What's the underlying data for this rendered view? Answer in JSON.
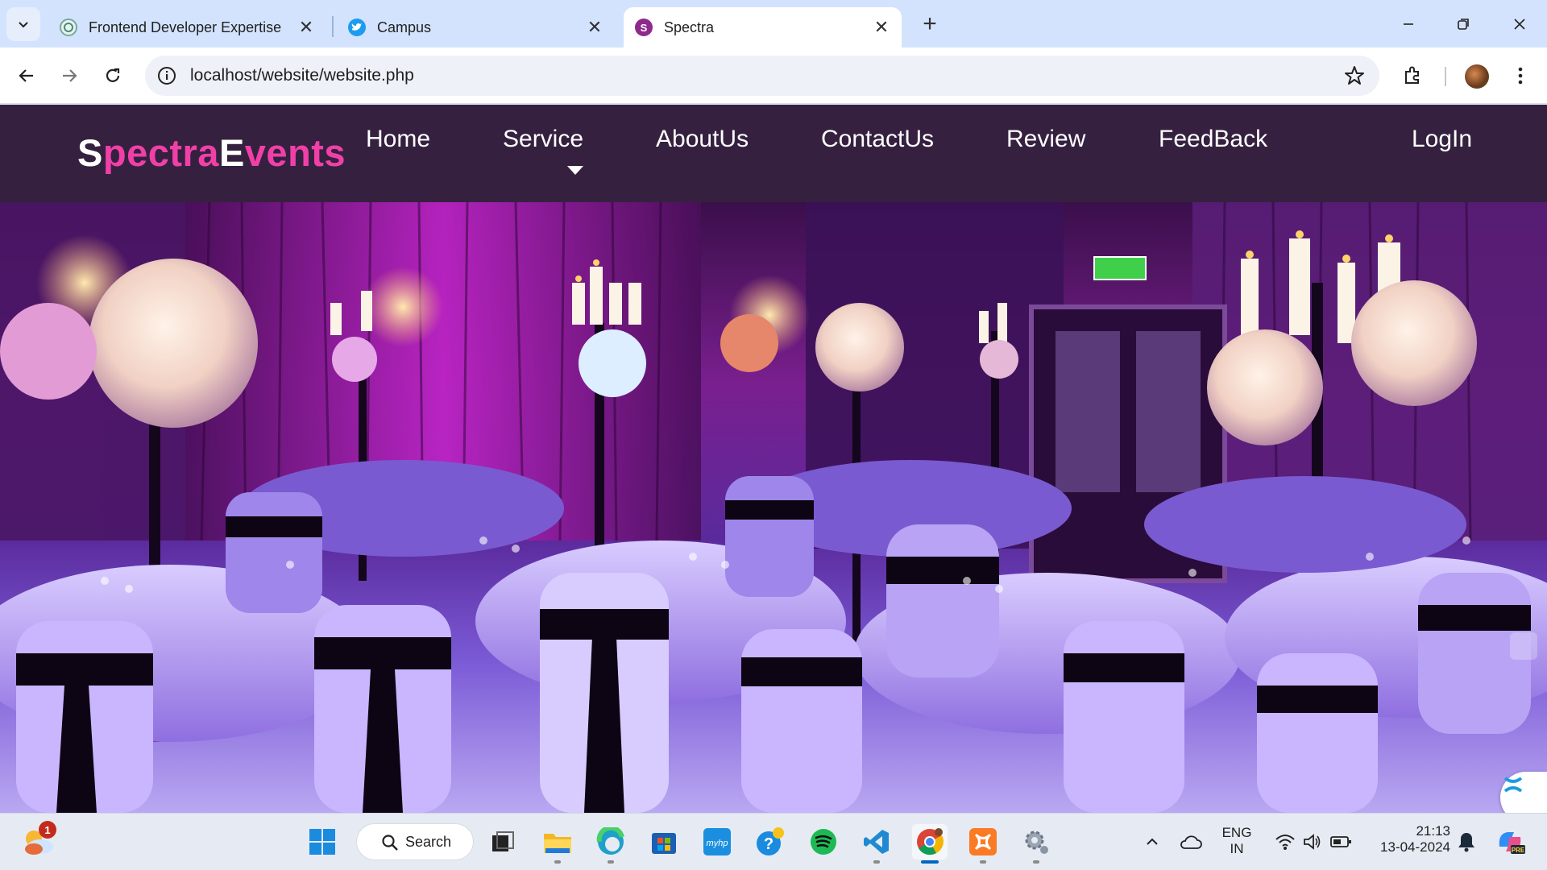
{
  "browser": {
    "tabs": [
      {
        "title": "Frontend Developer Expertise",
        "icon": "chatgpt-icon",
        "active": false
      },
      {
        "title": "Campus",
        "icon": "twitter-icon",
        "active": false
      },
      {
        "title": "Spectra",
        "icon": "spectra-icon",
        "active": true
      }
    ],
    "url": "localhost/website/website.php"
  },
  "site": {
    "brand": {
      "cap1": "S",
      "part1": "pectra",
      "cap2": "E",
      "part2": "vents"
    },
    "nav": {
      "home": "Home",
      "service": "Service",
      "aboutus": "AboutUs",
      "contactus": "ContactUs",
      "review": "Review",
      "feedback": "FeedBack",
      "login": "LogIn"
    },
    "hero_image": "banquet-hall-photo",
    "colors": {
      "nav_bg": "#35213f",
      "brand_pink": "#f040a8"
    }
  },
  "taskbar": {
    "search_label": "Search",
    "weather_badge": "1",
    "language_line1": "ENG",
    "language_line2": "IN",
    "time": "21:13",
    "date": "13-04-2024"
  }
}
